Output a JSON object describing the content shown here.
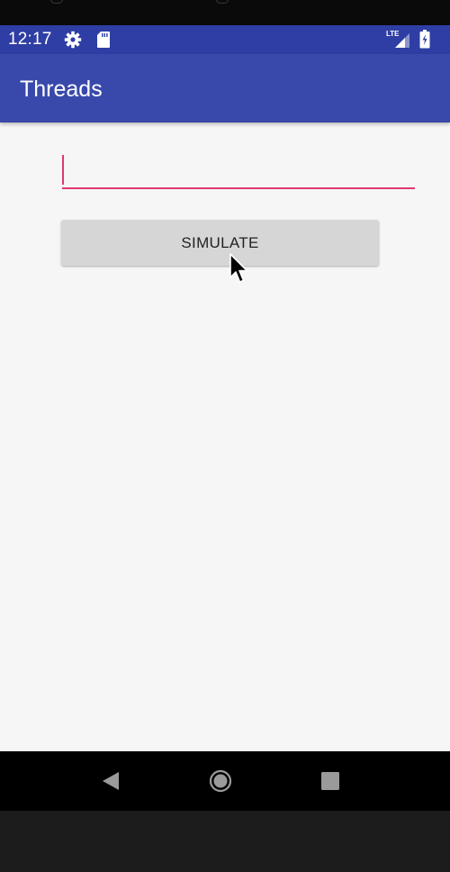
{
  "status_bar": {
    "time": "12:17",
    "network_label": "LTE",
    "icons": [
      "gear-icon",
      "sd-card-icon",
      "signal-icon",
      "battery-charging-icon"
    ],
    "background": "#2f3ea4"
  },
  "app_bar": {
    "title": "Threads",
    "background": "#3949ab"
  },
  "main": {
    "input": {
      "value": "",
      "placeholder": "",
      "accent": "#e0386f"
    },
    "simulate_button": {
      "label": "SIMULATE",
      "background": "#d6d6d6"
    }
  },
  "nav_bar": {
    "icons": [
      "back-icon",
      "home-icon",
      "recents-icon"
    ]
  }
}
